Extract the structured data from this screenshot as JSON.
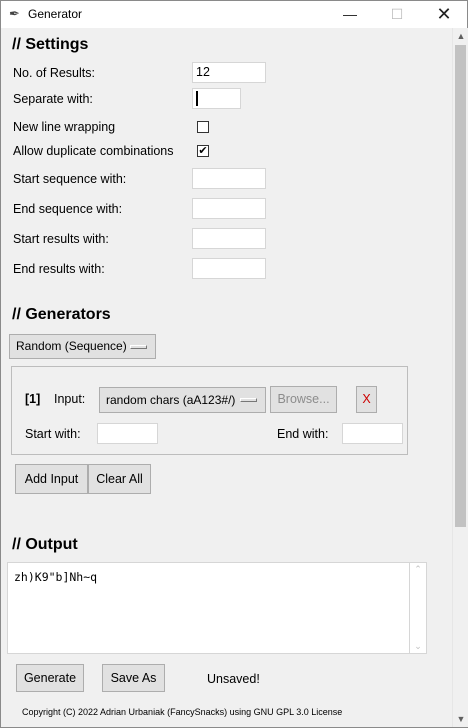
{
  "window": {
    "title": "Generator",
    "minimize": "—",
    "maximize": "☐",
    "close": "✕"
  },
  "settings": {
    "heading": "// Settings",
    "num_results_label": "No. of Results:",
    "num_results_value": "12",
    "separate_label": "Separate with:",
    "separate_value": "",
    "newline_label": "New line wrapping",
    "newline_checked": false,
    "duplicates_label": "Allow duplicate combinations",
    "duplicates_checked": true,
    "duplicates_mark": "✔",
    "start_seq_label": "Start sequence with:",
    "start_seq_value": "",
    "end_seq_label": "End sequence with:",
    "end_seq_value": "",
    "start_res_label": "Start results with:",
    "start_res_value": "",
    "end_res_label": "End results with:",
    "end_res_value": ""
  },
  "generators": {
    "heading": "// Generators",
    "mode": "Random (Sequence)",
    "input": {
      "index": "[1]",
      "input_label": "Input:",
      "input_value": "random chars (aA123#/)",
      "browse_label": "Browse...",
      "remove_label": "X",
      "start_label": "Start with:",
      "start_value": "",
      "end_label": "End with:",
      "end_value": ""
    },
    "add_input_label": "Add Input",
    "clear_all_label": "Clear All"
  },
  "output": {
    "heading": "// Output",
    "text": "zh)K9\"b]Nh~q"
  },
  "actions": {
    "generate_label": "Generate",
    "save_as_label": "Save As",
    "status": "Unsaved!"
  },
  "footer": {
    "copyright": "Copyright (C) 2022 Adrian Urbaniak (FancySnacks) using GNU GPL 3.0 License"
  },
  "icons": {
    "app": "✒",
    "scroll_up": "▲",
    "scroll_down": "▼",
    "out_up": "⌃",
    "out_down": "⌄"
  },
  "colors": {
    "window_bg": "#f0f0f0",
    "remove_button_text": "#cc0000",
    "browse_disabled_text": "#8c8c8c"
  }
}
